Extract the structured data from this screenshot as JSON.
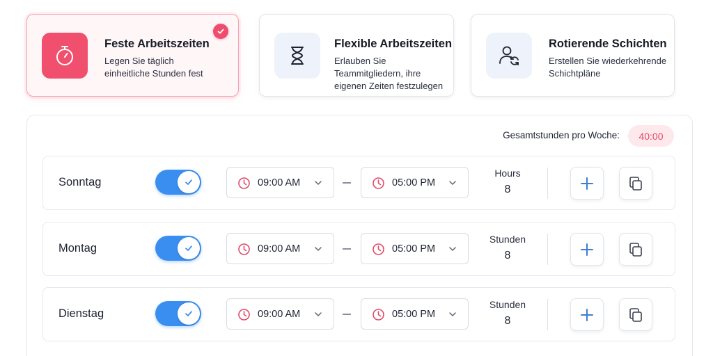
{
  "colors": {
    "accent": "#f0506e",
    "toggle_on": "#3a8ef0",
    "badge_bg": "#fde8ec",
    "badge_text": "#e04a68"
  },
  "schedule_types": [
    {
      "title": "Feste Arbeitszeiten",
      "description": [
        "Legen Sie täglich",
        "einheitliche Stunden fest"
      ],
      "icon": "stopwatch-icon",
      "selected": true
    },
    {
      "title": "Flexible Arbeitszeiten",
      "description": [
        "Erlauben Sie",
        "Teammitgliedern, ihre",
        "eigenen Zeiten festzulegen"
      ],
      "icon": "hourglass-icon",
      "selected": false
    },
    {
      "title": "Rotierende Schichten",
      "description": [
        "Erstellen Sie wiederkehrende",
        "Schichtpläne"
      ],
      "icon": "user-rotate-icon",
      "selected": false
    }
  ],
  "summary": {
    "total_label": "Gesamtstunden pro Woche:",
    "total_value": "40:00"
  },
  "days": [
    {
      "name": "Sonntag",
      "enabled": true,
      "start": "09:00 AM",
      "end": "05:00 PM",
      "hours_label": "Hours",
      "hours": "8"
    },
    {
      "name": "Montag",
      "enabled": true,
      "start": "09:00 AM",
      "end": "05:00 PM",
      "hours_label": "Stunden",
      "hours": "8"
    },
    {
      "name": "Dienstag",
      "enabled": true,
      "start": "09:00 AM",
      "end": "05:00 PM",
      "hours_label": "Stunden",
      "hours": "8"
    }
  ]
}
